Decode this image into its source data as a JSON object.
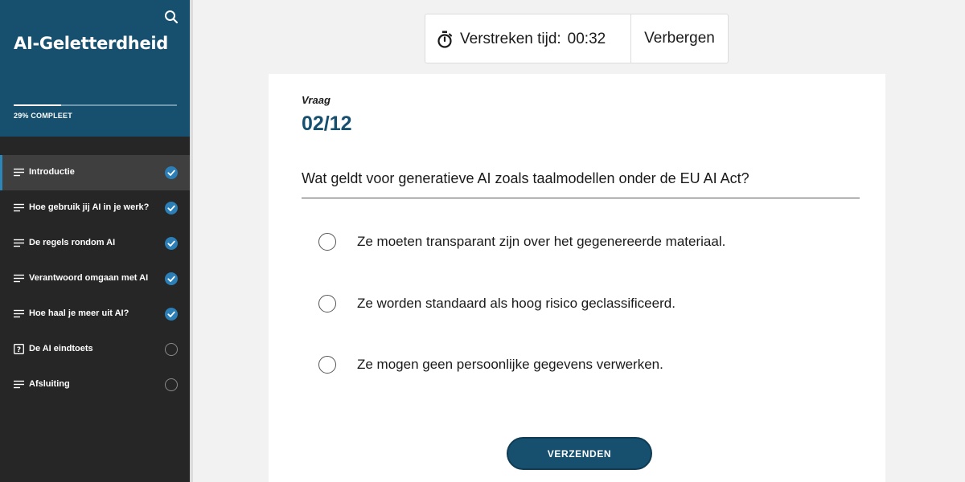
{
  "sidebar": {
    "title": "AI-Geletterdheid",
    "progress_label": "29% COMPLEET",
    "progress_fraction": 0.29,
    "search_icon": "search-icon",
    "items": [
      {
        "label": "Introductie",
        "icon": "lesson-lines-icon",
        "status": "done",
        "active": true
      },
      {
        "label": "Hoe gebruik jij AI in je werk?",
        "icon": "lesson-lines-icon",
        "status": "done",
        "active": false
      },
      {
        "label": "De regels rondom AI",
        "icon": "lesson-lines-icon",
        "status": "done",
        "active": false
      },
      {
        "label": "Verantwoord omgaan met AI",
        "icon": "lesson-lines-icon",
        "status": "done",
        "active": false
      },
      {
        "label": "Hoe haal je meer uit AI?",
        "icon": "lesson-lines-icon",
        "status": "done",
        "active": false
      },
      {
        "label": "De AI eindtoets",
        "icon": "quiz-question-icon",
        "status": "todo",
        "active": false
      },
      {
        "label": "Afsluiting",
        "icon": "lesson-lines-icon",
        "status": "todo",
        "active": false
      }
    ]
  },
  "timer": {
    "label": "Verstreken tijd:",
    "value": "00:32",
    "hide_label": "Verbergen",
    "icon": "stopwatch-icon"
  },
  "quiz": {
    "question_label": "Vraag",
    "question_number": "02/12",
    "question_text": "Wat geldt voor generatieve AI zoals taalmodellen onder de EU AI Act?",
    "options": [
      "Ze moeten transparant zijn over het gegenereerde materiaal.",
      "Ze worden standaard als hoog risico geclassificeerd.",
      "Ze mogen geen persoonlijke gegevens verwerken."
    ],
    "submit_label": "VERZENDEN"
  },
  "colors": {
    "brand": "#17506f",
    "sidebar_bg": "#262626",
    "check_blue": "#2b7fb6"
  }
}
